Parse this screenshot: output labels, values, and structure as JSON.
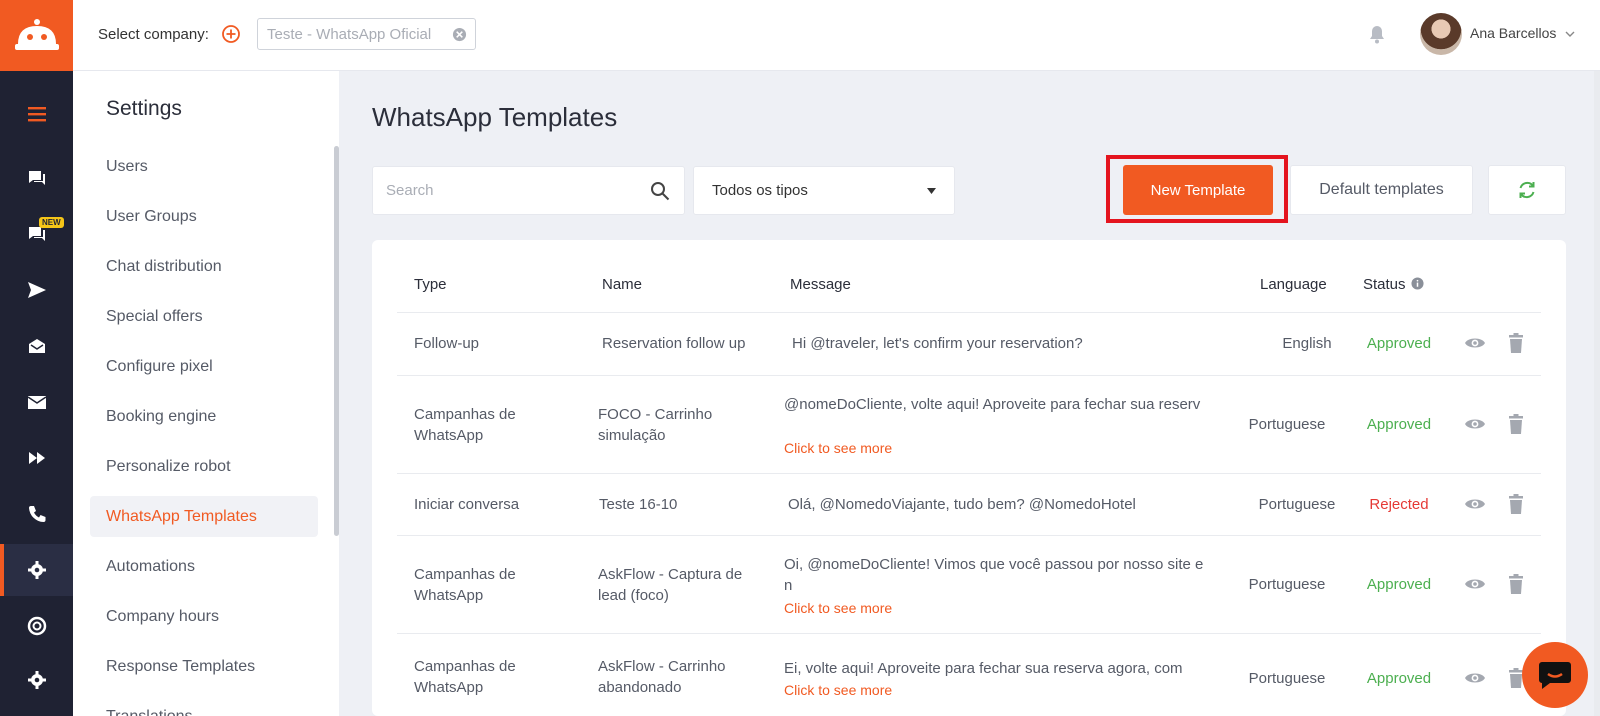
{
  "colors": {
    "accent": "#f15a22",
    "rail": "#1f2233",
    "approved": "#4caf50",
    "rejected": "#e53935",
    "highlight": "#e4141e"
  },
  "topbar": {
    "select_company_label": "Select company:",
    "company_value": "Teste - WhatsApp Oficial",
    "user_name": "Ana Barcellos"
  },
  "rail": {
    "icons": [
      "menu-icon",
      "chat-icon",
      "chat-new-icon",
      "send-icon",
      "inbox-icon",
      "mail-icon",
      "fast-forward-icon",
      "phone-icon",
      "settings-icon",
      "support-icon",
      "settings-secondary-icon"
    ],
    "new_badge": "NEW"
  },
  "settings": {
    "title": "Settings",
    "items": [
      {
        "label": "Users"
      },
      {
        "label": "User Groups"
      },
      {
        "label": "Chat distribution"
      },
      {
        "label": "Special offers"
      },
      {
        "label": "Configure pixel"
      },
      {
        "label": "Booking engine"
      },
      {
        "label": "Personalize robot"
      },
      {
        "label": "WhatsApp Templates",
        "active": true
      },
      {
        "label": "Automations"
      },
      {
        "label": "Company hours"
      },
      {
        "label": "Response Templates"
      },
      {
        "label": "Translations"
      }
    ]
  },
  "main": {
    "title": "WhatsApp Templates",
    "search_placeholder": "Search",
    "type_filter": "Todos os tipos",
    "new_template_label": "New Template",
    "default_templates_label": "Default templates"
  },
  "table": {
    "headers": {
      "type": "Type",
      "name": "Name",
      "message": "Message",
      "language": "Language",
      "status": "Status"
    },
    "see_more": "Click to see more",
    "rows": [
      {
        "type": "Follow-up",
        "name": "Reservation follow up",
        "message": "Hi @traveler, let's confirm your reservation?",
        "language": "English",
        "status": "Approved"
      },
      {
        "type": "Campanhas de WhatsApp",
        "name": "FOCO - Carrinho simulação",
        "message": "@nomeDoCliente, volte aqui! Aproveite para fechar sua reserv",
        "language": "Portuguese",
        "status": "Approved",
        "more": true
      },
      {
        "type": "Iniciar conversa",
        "name": "Teste 16-10",
        "message": "Olá, @NomedoViajante, tudo bem? @NomedoHotel",
        "language": "Portuguese",
        "status": "Rejected"
      },
      {
        "type": "Campanhas de WhatsApp",
        "name": "AskFlow - Captura de lead (foco)",
        "message": "Oi, @nomeDoCliente! Vimos que você passou por nosso site e n",
        "language": "Portuguese",
        "status": "Approved",
        "more": true
      },
      {
        "type": "Campanhas de WhatsApp",
        "name": "AskFlow - Carrinho abandonado",
        "message": "Ei, volte aqui! Aproveite para fechar sua reserva agora, com",
        "language": "Portuguese",
        "status": "Approved",
        "more": true
      }
    ]
  }
}
